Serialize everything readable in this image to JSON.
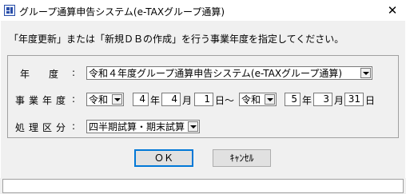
{
  "window": {
    "title": "グループ通算申告システム(e-TAXグループ通算)",
    "close_glyph": "✕"
  },
  "instruction": "「年度更新」または「新規ＤＢの作成」を行う事業年度を指定してください。",
  "fields": {
    "year": {
      "label": "年　　度",
      "colon": ":",
      "value": "令和４年度グループ通算申告システム(e-TAXグループ通算)"
    },
    "period": {
      "label": "事業年度",
      "colon": ":",
      "start": {
        "era": "令和",
        "year": "4",
        "year_unit": "年",
        "month": "4",
        "month_unit": "月",
        "day": "1",
        "day_unit": "日"
      },
      "separator": "～",
      "end": {
        "era": "令和",
        "year": "5",
        "year_unit": "年",
        "month": "3",
        "month_unit": "月",
        "day": "31",
        "day_unit": "日"
      }
    },
    "category": {
      "label": "処理区分",
      "colon": ":",
      "value": "四半期試算・期末試算"
    }
  },
  "buttons": {
    "ok": "ＯＫ",
    "cancel": "ｷｬﾝｾﾙ"
  },
  "status": {
    "text": ""
  }
}
